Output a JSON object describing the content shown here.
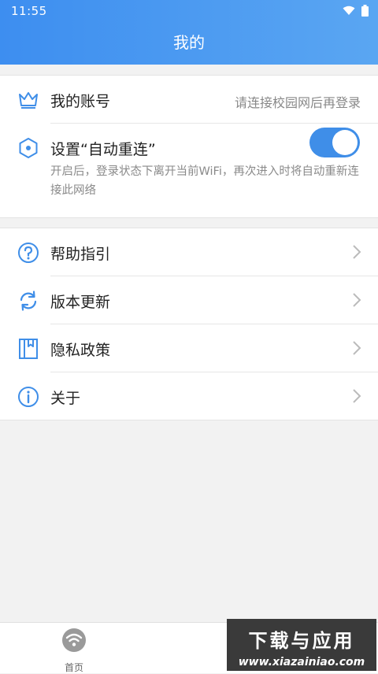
{
  "status_bar": {
    "time": "11:55"
  },
  "header": {
    "title": "我的"
  },
  "account": {
    "label": "我的账号",
    "hint": "请连接校园网后再登录"
  },
  "auto_reconnect": {
    "label": "设置“自动重连”",
    "description": "开启后，登录状态下离开当前WiFi，再次进入时将自动重新连接此网络",
    "enabled": true
  },
  "menu": {
    "items": [
      {
        "label": "帮助指引",
        "icon": "help-circle-icon"
      },
      {
        "label": "版本更新",
        "icon": "refresh-icon"
      },
      {
        "label": "隐私政策",
        "icon": "book-icon"
      },
      {
        "label": "关于",
        "icon": "info-icon"
      }
    ]
  },
  "tabbar": {
    "home_label": "首页"
  },
  "watermark": {
    "main": "下载与应用",
    "url": "www.xiazainiao.com"
  },
  "colors": {
    "accent": "#3f8ee8",
    "header_start": "#3d8ef0",
    "header_end": "#5aa6f2"
  }
}
